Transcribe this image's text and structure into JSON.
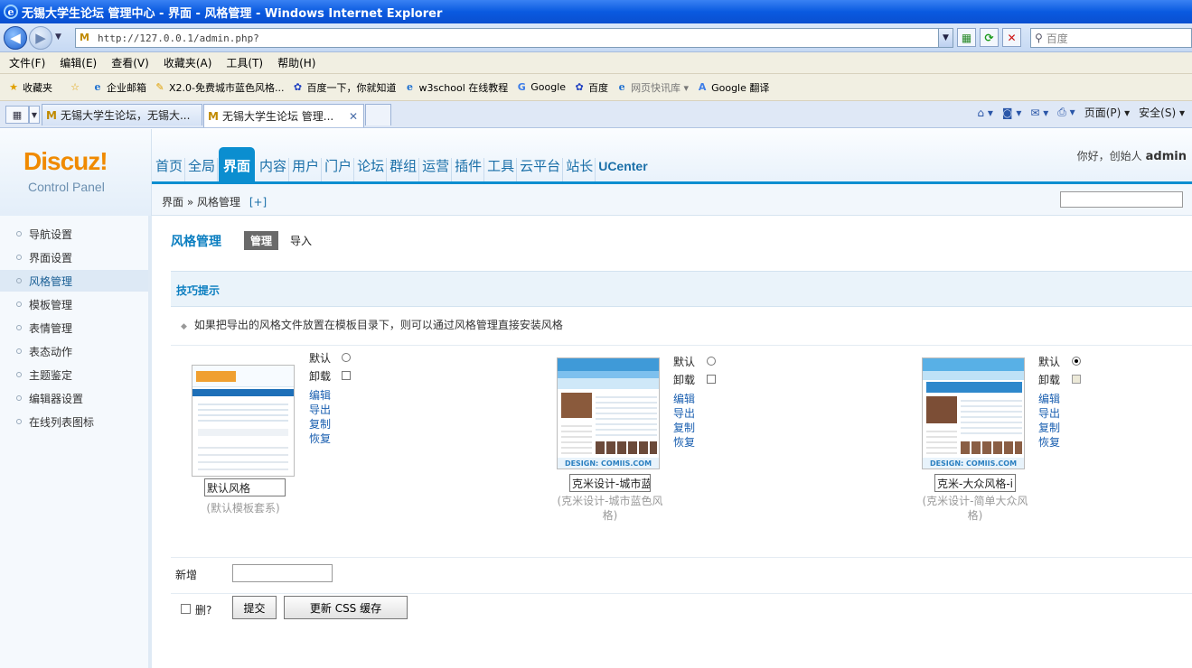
{
  "browser": {
    "title": "无锡大学生论坛 管理中心 - 界面 - 风格管理 - Windows Internet Explorer",
    "url": "http://127.0.0.1/admin.php?",
    "search_placeholder": "百度",
    "menu": [
      "文件(F)",
      "编辑(E)",
      "查看(V)",
      "收藏夹(A)",
      "工具(T)",
      "帮助(H)"
    ],
    "favorites_label": "收藏夹",
    "favorites": [
      {
        "label": "企业邮箱",
        "icon": "ie-page-icon"
      },
      {
        "label": "X2.0-免费城市蓝色风格...",
        "icon": "link-icon"
      },
      {
        "label": "百度一下，你就知道",
        "icon": "baidu-paw-icon"
      },
      {
        "label": "w3school 在线教程",
        "icon": "ie-page-icon"
      },
      {
        "label": "Google",
        "icon": "google-icon"
      },
      {
        "label": "百度",
        "icon": "baidu-paw-icon"
      },
      {
        "label": "网页快讯库 ▾",
        "icon": "ie-page-icon"
      },
      {
        "label": "Google 翻译",
        "icon": "google-translate-icon"
      }
    ],
    "tabs": [
      {
        "label": "无锡大学生论坛，无锡大..."
      },
      {
        "label": "无锡大学生论坛 管理..."
      }
    ],
    "commands": {
      "page": "页面(P) ▾",
      "safety": "安全(S) ▾"
    }
  },
  "header": {
    "logo": "Discuz!",
    "logo_sub": "Control Panel",
    "nav": [
      "首页",
      "全局",
      "界面",
      "内容",
      "用户",
      "门户",
      "论坛",
      "群组",
      "运营",
      "插件",
      "工具",
      "云平台",
      "站长",
      "UCenter"
    ],
    "active_nav": "界面",
    "greeting": "你好，创始人",
    "username": "admin",
    "breadcrumb": "界面 » 风格管理",
    "breadcrumb_plus": "[+]"
  },
  "sidebar": {
    "items": [
      "导航设置",
      "界面设置",
      "风格管理",
      "模板管理",
      "表情管理",
      "表态动作",
      "主题鉴定",
      "编辑器设置",
      "在线列表图标"
    ],
    "active": "风格管理"
  },
  "main": {
    "title": "风格管理",
    "tab_manage": "管理",
    "tab_import": "导入",
    "tips_title": "技巧提示",
    "tips_text": "如果把导出的风格文件放置在模板目录下，则可以通过风格管理直接安装风格",
    "option_default": "默认",
    "option_uninstall": "卸载",
    "ops": [
      "编辑",
      "导出",
      "复制",
      "恢复"
    ],
    "styles": [
      {
        "name": "默认风格",
        "desc": "(默认模板套系)",
        "default": false,
        "thumb": "discuz-default"
      },
      {
        "name": "克米设计-城市蓝",
        "desc": "(克米设计-城市蓝色风格)",
        "default": false,
        "thumb": "comiis-blue"
      },
      {
        "name": "克米-大众风格-i",
        "desc": "(克米设计-简单大众风格)",
        "default": true,
        "thumb": "comiis-simple"
      }
    ],
    "new_label": "新增",
    "delete_label": "删?",
    "submit_label": "提交",
    "css_cache_label": "更新 CSS 缓存"
  },
  "colors": {
    "accent": "#0b8ed0",
    "logo": "#f08a00",
    "link": "#1a5fb0"
  }
}
